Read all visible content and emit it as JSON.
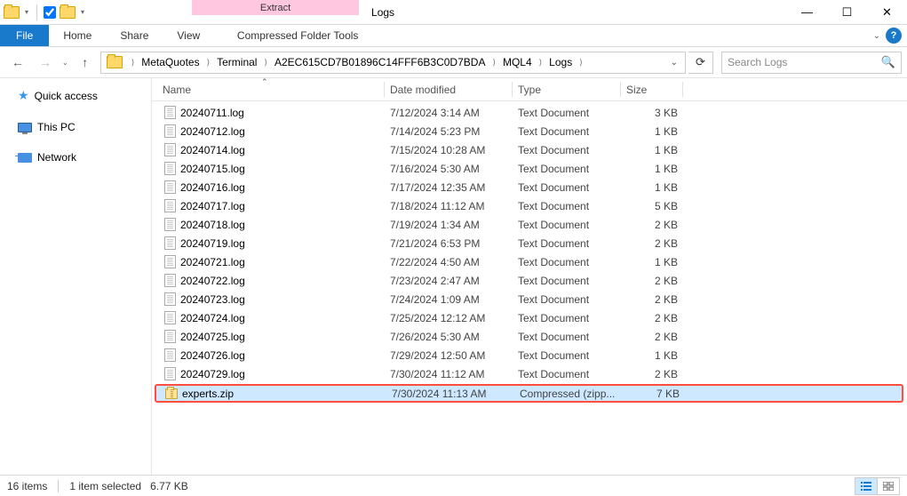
{
  "window": {
    "title": "Logs",
    "contextual_tab_label": "Extract",
    "contextual_tab_group": "Compressed Folder Tools"
  },
  "ribbon": {
    "file": "File",
    "tabs": [
      "Home",
      "Share",
      "View"
    ]
  },
  "breadcrumb": {
    "items": [
      "MetaQuotes",
      "Terminal",
      "A2EC615CD7B01896C14FFF6B3C0D7BDA",
      "MQL4",
      "Logs"
    ]
  },
  "search": {
    "placeholder": "Search Logs"
  },
  "navpane": {
    "quick_access": "Quick access",
    "this_pc": "This PC",
    "network": "Network"
  },
  "columns": {
    "name": "Name",
    "date": "Date modified",
    "type": "Type",
    "size": "Size"
  },
  "rows": [
    {
      "name": "20240711.log",
      "date": "7/12/2024 3:14 AM",
      "type": "Text Document",
      "size": "3 KB",
      "icon": "txt"
    },
    {
      "name": "20240712.log",
      "date": "7/14/2024 5:23 PM",
      "type": "Text Document",
      "size": "1 KB",
      "icon": "txt"
    },
    {
      "name": "20240714.log",
      "date": "7/15/2024 10:28 AM",
      "type": "Text Document",
      "size": "1 KB",
      "icon": "txt"
    },
    {
      "name": "20240715.log",
      "date": "7/16/2024 5:30 AM",
      "type": "Text Document",
      "size": "1 KB",
      "icon": "txt"
    },
    {
      "name": "20240716.log",
      "date": "7/17/2024 12:35 AM",
      "type": "Text Document",
      "size": "1 KB",
      "icon": "txt"
    },
    {
      "name": "20240717.log",
      "date": "7/18/2024 11:12 AM",
      "type": "Text Document",
      "size": "5 KB",
      "icon": "txt"
    },
    {
      "name": "20240718.log",
      "date": "7/19/2024 1:34 AM",
      "type": "Text Document",
      "size": "2 KB",
      "icon": "txt"
    },
    {
      "name": "20240719.log",
      "date": "7/21/2024 6:53 PM",
      "type": "Text Document",
      "size": "2 KB",
      "icon": "txt"
    },
    {
      "name": "20240721.log",
      "date": "7/22/2024 4:50 AM",
      "type": "Text Document",
      "size": "1 KB",
      "icon": "txt"
    },
    {
      "name": "20240722.log",
      "date": "7/23/2024 2:47 AM",
      "type": "Text Document",
      "size": "2 KB",
      "icon": "txt"
    },
    {
      "name": "20240723.log",
      "date": "7/24/2024 1:09 AM",
      "type": "Text Document",
      "size": "2 KB",
      "icon": "txt"
    },
    {
      "name": "20240724.log",
      "date": "7/25/2024 12:12 AM",
      "type": "Text Document",
      "size": "2 KB",
      "icon": "txt"
    },
    {
      "name": "20240725.log",
      "date": "7/26/2024 5:30 AM",
      "type": "Text Document",
      "size": "2 KB",
      "icon": "txt"
    },
    {
      "name": "20240726.log",
      "date": "7/29/2024 12:50 AM",
      "type": "Text Document",
      "size": "1 KB",
      "icon": "txt"
    },
    {
      "name": "20240729.log",
      "date": "7/30/2024 11:12 AM",
      "type": "Text Document",
      "size": "2 KB",
      "icon": "txt"
    },
    {
      "name": "experts.zip",
      "date": "7/30/2024 11:13 AM",
      "type": "Compressed (zipp...",
      "size": "7 KB",
      "icon": "zip",
      "selected": true,
      "highlighted": true
    }
  ],
  "statusbar": {
    "items": "16 items",
    "selected": "1 item selected",
    "size": "6.77 KB"
  }
}
